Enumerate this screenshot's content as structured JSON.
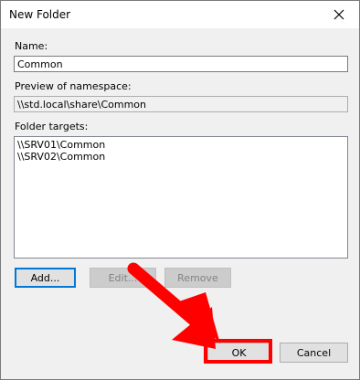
{
  "dialog": {
    "title": "New Folder"
  },
  "form": {
    "name_label": "Name:",
    "name_value": "Common",
    "preview_label": "Preview of namespace:",
    "preview_value": "\\\\std.local\\share\\Common",
    "targets_label": "Folder targets:",
    "targets": [
      "\\\\SRV01\\Common",
      "\\\\SRV02\\Common"
    ]
  },
  "buttons": {
    "add": "Add...",
    "edit": "Edit...",
    "remove": "Remove",
    "ok": "OK",
    "cancel": "Cancel"
  },
  "icons": {
    "close": "close-icon",
    "annotation": "red-arrow-icon"
  },
  "colors": {
    "annotation": "#ff0000",
    "focus": "#0078d7"
  }
}
